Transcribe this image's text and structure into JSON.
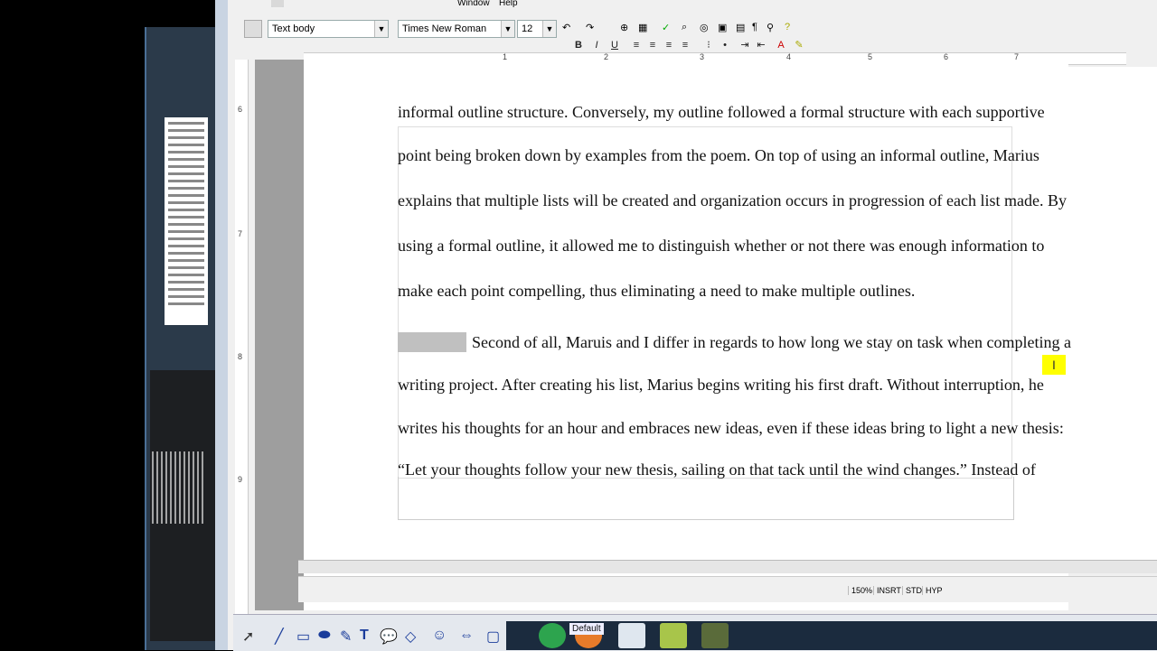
{
  "menu": {
    "window_label": "Window",
    "help_label": "Help"
  },
  "toolbar": {
    "paragraph_style": "Text body",
    "font_name": "Times New Roman",
    "font_size": "12",
    "bold_label": "B",
    "italic_label": "I",
    "underline_label": "U"
  },
  "ruler_numbers": [
    "1",
    "2",
    "3",
    "4",
    "5",
    "6",
    "7"
  ],
  "vruler_numbers": [
    "6",
    "7",
    "8",
    "9"
  ],
  "document": {
    "lines": [
      "informal outline structure. Conversely, my outline followed a formal structure with each supportive",
      "point being broken down by examples from the poem. On top of using an informal outline, Marius",
      "explains that multiple lists will be created and organization occurs in progression of each list made. By",
      "using a formal outline, it allowed me to distinguish whether or not there was enough information to",
      "make each point compelling, thus eliminating a need to make multiple outlines.",
      "Second of all, Maruis and I differ in regards to how long we stay on task when completing a",
      "writing project. After creating his list, Marius begins writing his first draft. Without interruption, he",
      "writes his thoughts for an hour and embraces new ideas, even if these ideas bring to light a new thesis:",
      "“Let your thoughts follow your new thesis, sailing on that tack until the wind changes.” Instead of"
    ]
  },
  "status": {
    "zoom": "150%",
    "insert_mode": "INSRT",
    "selection_mode": "STD",
    "hyperlink_mode": "HYP"
  },
  "drawing": {
    "default_label": "Default",
    "text_tool": "T"
  }
}
